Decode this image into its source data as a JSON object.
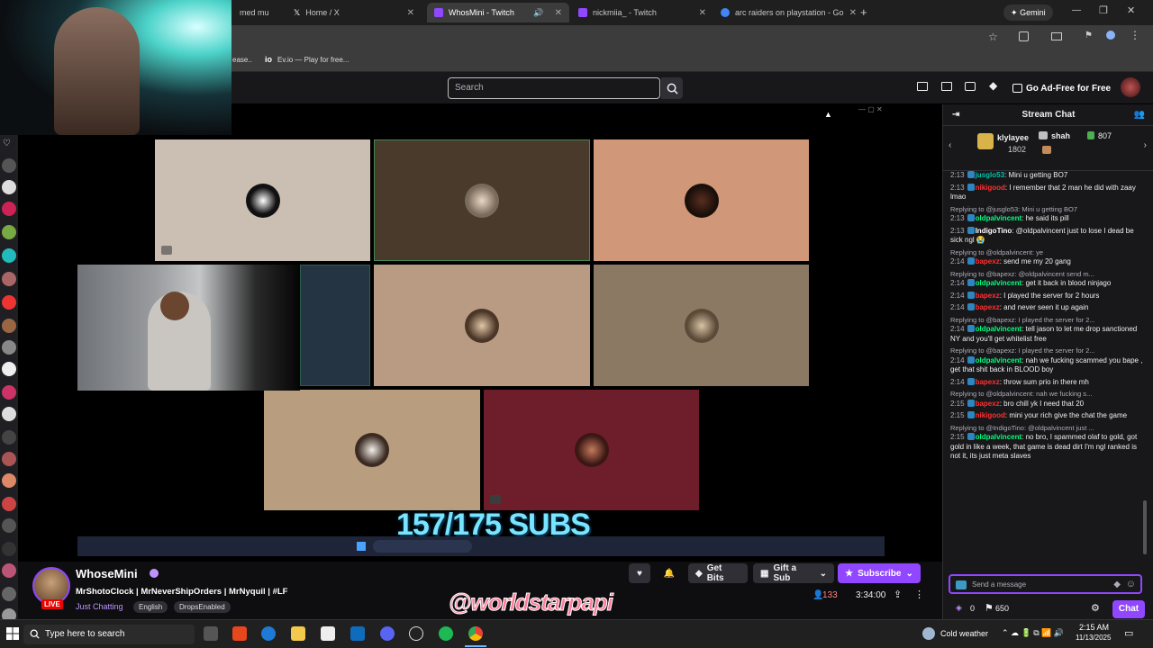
{
  "browser": {
    "tabs": [
      {
        "label": "med mu",
        "active": false
      },
      {
        "label": "Home / X",
        "active": false
      },
      {
        "label": "WhosMini - Twitch",
        "active": true
      },
      {
        "label": "nickmiia_ - Twitch",
        "active": false
      },
      {
        "label": "arc raiders on playstation - Go",
        "active": false
      }
    ],
    "gemini_label": "Gemini",
    "bookmarks": [
      "ease..",
      "Ev.io — Play for free..."
    ]
  },
  "twitch_nav": {
    "search_placeholder": "Search",
    "ad_free_label": "Go Ad-Free for Free"
  },
  "stream": {
    "subs_goal": "157/175 SUBS",
    "tile_colors": [
      "#cbbfb3",
      "#4a3a2c",
      "#d09779",
      "#253442",
      "#b89b82",
      "#8b7964",
      "#b89e7f",
      "#6e1e2a"
    ]
  },
  "channel": {
    "name": "WhoseMini",
    "live_label": "LIVE",
    "title": "MrShotoClock | MrNeverShipOrders | MrNyquil | #LF",
    "category": "Just Chatting",
    "tags": [
      "English",
      "DropsEnabled"
    ],
    "get_bits_label": "Get Bits",
    "gift_sub_label": "Gift a Sub",
    "subscribe_label": "Subscribe",
    "viewers": "133",
    "uptime": "3:34:00",
    "watermark": "@worldstarpapi"
  },
  "chat": {
    "header": "Stream Chat",
    "gifters": [
      {
        "name": "klylayee",
        "count": "1802"
      },
      {
        "name": "shah",
        "count": ""
      },
      {
        "name": "",
        "count": "807"
      }
    ],
    "messages": [
      {
        "time": "2:13",
        "user": "jusglo53",
        "color": "#00c2a8",
        "text": "Mini u getting BO7",
        "reply": ""
      },
      {
        "time": "2:13",
        "user": "nikigood",
        "color": "#ff3030",
        "text": "I remember that 2 man he did with zaay lmao",
        "reply": ""
      },
      {
        "time": "2:13",
        "user": "oldpalvincent",
        "color": "#00ff7f",
        "text": "he said its pill",
        "reply": "Replying to @jusglo53: Mini u getting BO7"
      },
      {
        "time": "2:13",
        "user": "IndigoTino",
        "color": "#ffffff",
        "text": "@oldpalvincent just to lose I dead be sick ngl 😭",
        "reply": ""
      },
      {
        "time": "2:14",
        "user": "bapexz",
        "color": "#ff3030",
        "text": "send me my 20 gang",
        "reply": "Replying to @oldpalvincent: ye"
      },
      {
        "time": "2:14",
        "user": "oldpalvincent",
        "color": "#00ff7f",
        "text": "get it back in blood ninjago",
        "reply": "Replying to @bapexz: @oldpalvincent send m..."
      },
      {
        "time": "2:14",
        "user": "bapexz",
        "color": "#ff3030",
        "text": "I played the server for 2 hours",
        "reply": ""
      },
      {
        "time": "2:14",
        "user": "bapexz",
        "color": "#ff3030",
        "text": "and never seen it up again",
        "reply": ""
      },
      {
        "time": "2:14",
        "user": "oldpalvincent",
        "color": "#00ff7f",
        "text": "tell jason to let me drop sanctioned NY and you'll get whitelist free",
        "reply": "Replying to @bapexz: I played the server for 2..."
      },
      {
        "time": "2:14",
        "user": "oldpalvincent",
        "color": "#00ff7f",
        "text": "nah we fucking scammed you bape , get that shit back in BLOOD boy",
        "reply": "Replying to @bapexz: I played the server for 2..."
      },
      {
        "time": "2:14",
        "user": "bapexz",
        "color": "#ff3030",
        "text": "throw sum prio in there mh",
        "reply": ""
      },
      {
        "time": "2:15",
        "user": "bapexz",
        "color": "#ff3030",
        "text": "bro chill yk I need that 20",
        "reply": "Replying to @oldpalvincent: nah we fucking s..."
      },
      {
        "time": "2:15",
        "user": "nikigood",
        "color": "#ff3030",
        "text": "mini your rich give the chat the game",
        "reply": ""
      },
      {
        "time": "2:15",
        "user": "oldpalvincent",
        "color": "#00ff7f",
        "text": "no bro, I spammed olaf to gold, got gold in like a week, that game is dead dirt I'm ngl ranked is not it, its just meta slaves",
        "reply": "Replying to @IndigoTino: @oldpalvincent just ..."
      }
    ],
    "input_placeholder": "Send a message",
    "points": "0",
    "bits": "650",
    "chat_button": "Chat"
  },
  "taskbar": {
    "search_placeholder": "Type here to search",
    "weather": "Cold weather",
    "time": "2:15 AM",
    "date": "11/13/2025"
  }
}
